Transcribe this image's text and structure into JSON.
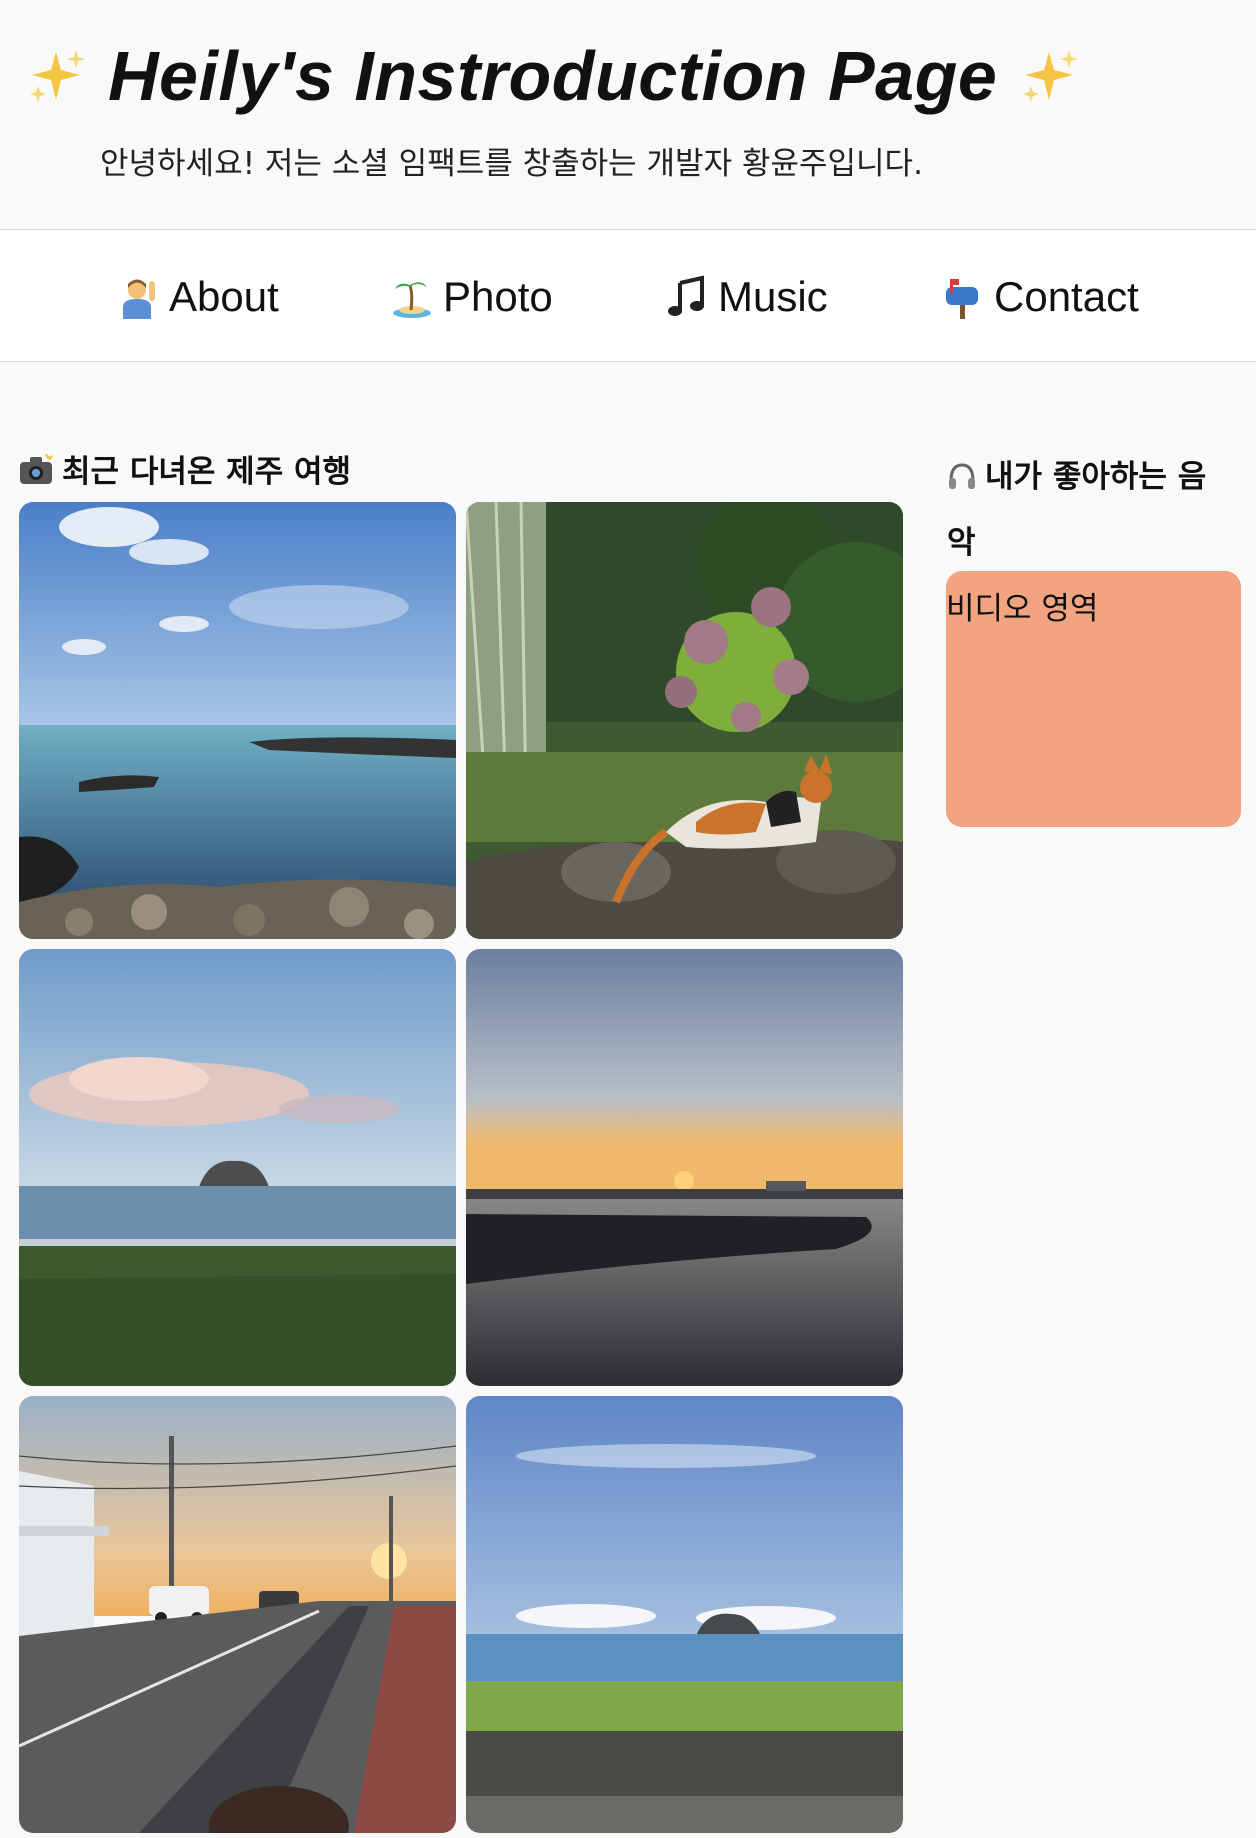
{
  "header": {
    "title": "Heily's Instroduction Page",
    "title_emoji": "✨",
    "subtitle": "안녕하세요! 저는 소셜 임팩트를 창출하는 개발자 황윤주입니다."
  },
  "nav": {
    "items": [
      {
        "label": "About",
        "icon": "person-raising-hand-icon"
      },
      {
        "label": "Photo",
        "icon": "desert-island-icon"
      },
      {
        "label": "Music",
        "icon": "music-note-icon"
      },
      {
        "label": "Contact",
        "icon": "mailbox-icon"
      }
    ]
  },
  "photos": {
    "heading": "최근 다녀온 제주 여행",
    "heading_icon": "camera-flash-icon",
    "items": [
      {
        "subject": "rocky sea shore under blue sky"
      },
      {
        "subject": "calico cat resting by hydrangea"
      },
      {
        "subject": "island across the sea at dusk"
      },
      {
        "subject": "sunset over harbor"
      },
      {
        "subject": "coastal road at sunset"
      },
      {
        "subject": "island view over grass and sea wall"
      }
    ]
  },
  "music": {
    "heading": "내가 좋아하는 음악",
    "heading_icon": "headphones-icon",
    "video_label": "비디오 영역"
  },
  "colors": {
    "video_bg": "#f2a380",
    "page_bg": "#f9f9f9",
    "nav_bg": "#ffffff"
  }
}
